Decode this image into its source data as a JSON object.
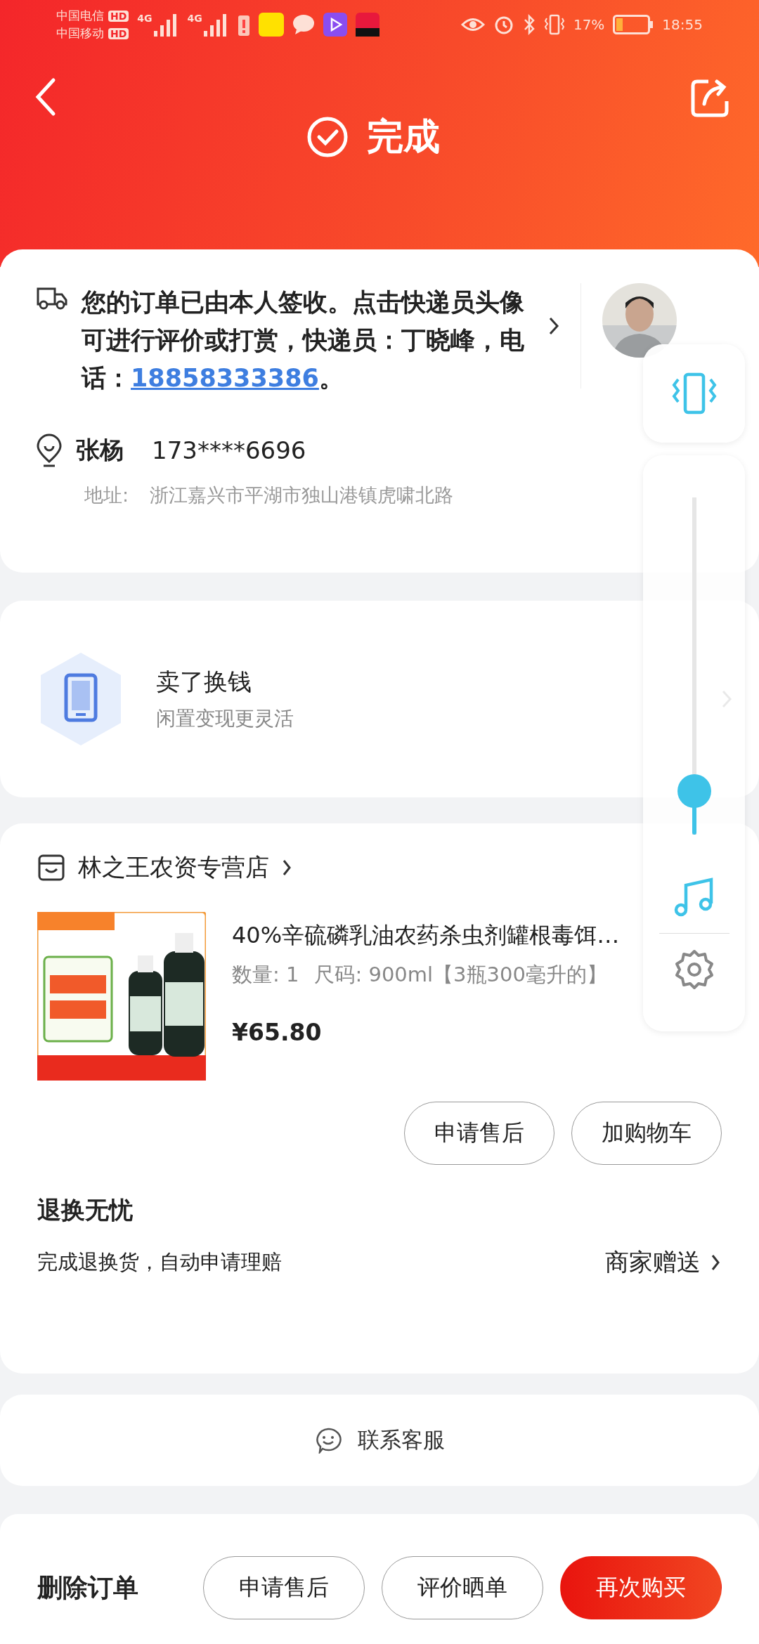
{
  "status_bar": {
    "carriers": [
      {
        "name": "中国电信",
        "badge": "HD",
        "network": "4G"
      },
      {
        "name": "中国移动",
        "badge": "HD",
        "network": "4G"
      }
    ],
    "battery": "17%",
    "time": "18:55"
  },
  "header": {
    "title": "完成"
  },
  "delivery": {
    "message": "您的订单已由本人签收。点击快递员头像可进行评价或打赏，快递员：丁晓峰，电话：",
    "phone": "18858333386",
    "message_end": "。"
  },
  "recipient": {
    "name": "张杨",
    "phone": "173****6696",
    "address_label": "地址:",
    "address": "浙江嘉兴市平湖市独山港镇虎啸北路"
  },
  "promo": {
    "title": "卖了换钱",
    "subtitle": "闲置变现更灵活"
  },
  "shop": {
    "name": "林之王农资专营店"
  },
  "product": {
    "title": "40%辛硫磷乳油农药杀虫剂罐根毒饵…",
    "quantity": "数量: 1",
    "spec": "尺码: 900ml【3瓶300毫升的】",
    "price": "¥65.80"
  },
  "product_buttons": [
    "申请售后",
    "加购物车"
  ],
  "guarantee": {
    "title": "退换无忧",
    "description": "完成退换货，自动申请理赔",
    "link": "商家赠送"
  },
  "contact": {
    "label": "联系客服"
  },
  "bottom_bar": {
    "delete": "删除订单",
    "buttons": [
      {
        "label": "申请售后",
        "primary": false
      },
      {
        "label": "评价晒单",
        "primary": false
      },
      {
        "label": "再次购买",
        "primary": true
      }
    ]
  },
  "volume_panel": {
    "level": 0.13
  }
}
